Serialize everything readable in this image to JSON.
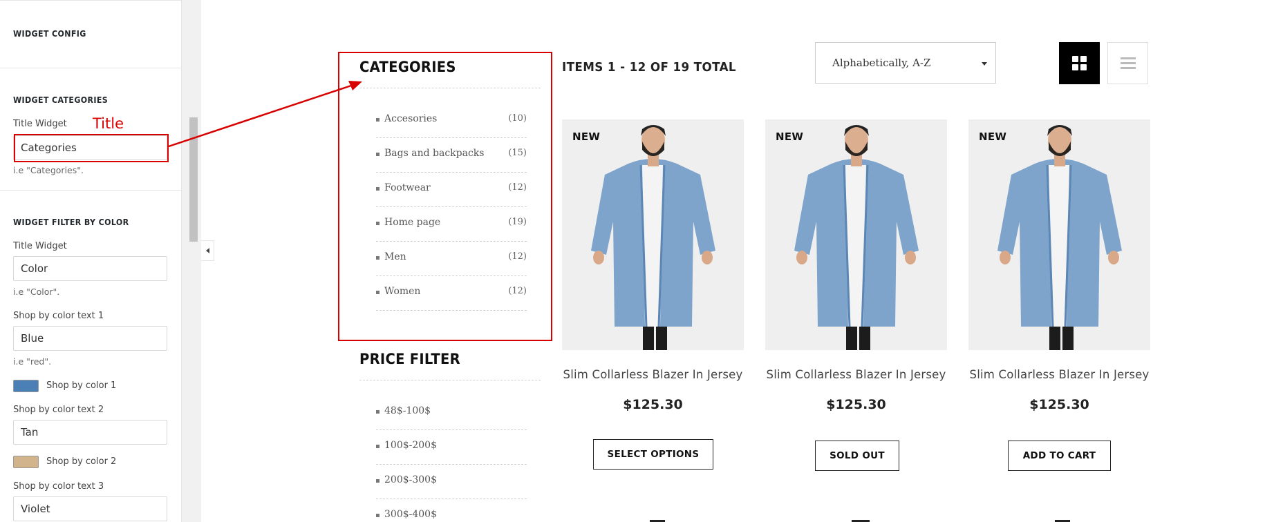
{
  "config_panel": {
    "widget_config_title": "WIDGET CONFIG",
    "categories_section": {
      "title": "WIDGET CATEGORIES",
      "title_widget_label": "Title Widget",
      "title_widget_value": "Categories",
      "title_widget_hint": "i.e \"Categories\"."
    },
    "color_section": {
      "title": "WIDGET FILTER BY COLOR",
      "title_widget_label": "Title Widget",
      "title_widget_value": "Color",
      "title_widget_hint": "i.e \"Color\".",
      "text1_label": "Shop by color text 1",
      "text1_value": "Blue",
      "text1_hint": "i.e \"red\".",
      "color1_label": "Shop by color 1",
      "color1": "#4a80b6",
      "text2_label": "Shop by color text 2",
      "text2_value": "Tan",
      "color2_label": "Shop by color 2",
      "color2": "#d2b48c",
      "text3_label": "Shop by color text 3",
      "text3_value": "Violet"
    }
  },
  "annotation": {
    "label": "Title",
    "color": "#d90000"
  },
  "shop_sidebar": {
    "categories": {
      "title": "CATEGORIES",
      "items": [
        {
          "name": "Accesories",
          "count": "(10)"
        },
        {
          "name": "Bags and backpacks",
          "count": "(15)"
        },
        {
          "name": "Footwear",
          "count": "(12)"
        },
        {
          "name": "Home page",
          "count": "(19)"
        },
        {
          "name": "Men",
          "count": "(12)"
        },
        {
          "name": "Women",
          "count": "(12)"
        }
      ]
    },
    "price_filter": {
      "title": "PRICE FILTER",
      "items": [
        "48$-100$",
        "100$-200$",
        "200$-300$",
        "300$-400$"
      ]
    }
  },
  "toolbar": {
    "items_total": "ITEMS 1 - 12 OF 19 TOTAL",
    "sort_value": "Alphabetically, A-Z",
    "grid_icon": "grid-view-icon",
    "list_icon": "list-view-icon"
  },
  "products": [
    {
      "badge": "NEW",
      "name": "Slim Collarless Blazer In Jersey",
      "price": "$125.30",
      "button": "SELECT OPTIONS"
    },
    {
      "badge": "NEW",
      "name": "Slim Collarless Blazer In Jersey",
      "price": "$125.30",
      "button": "SOLD OUT"
    },
    {
      "badge": "NEW",
      "name": "Slim Collarless Blazer In Jersey",
      "price": "$125.30",
      "button": "ADD TO CART"
    }
  ]
}
